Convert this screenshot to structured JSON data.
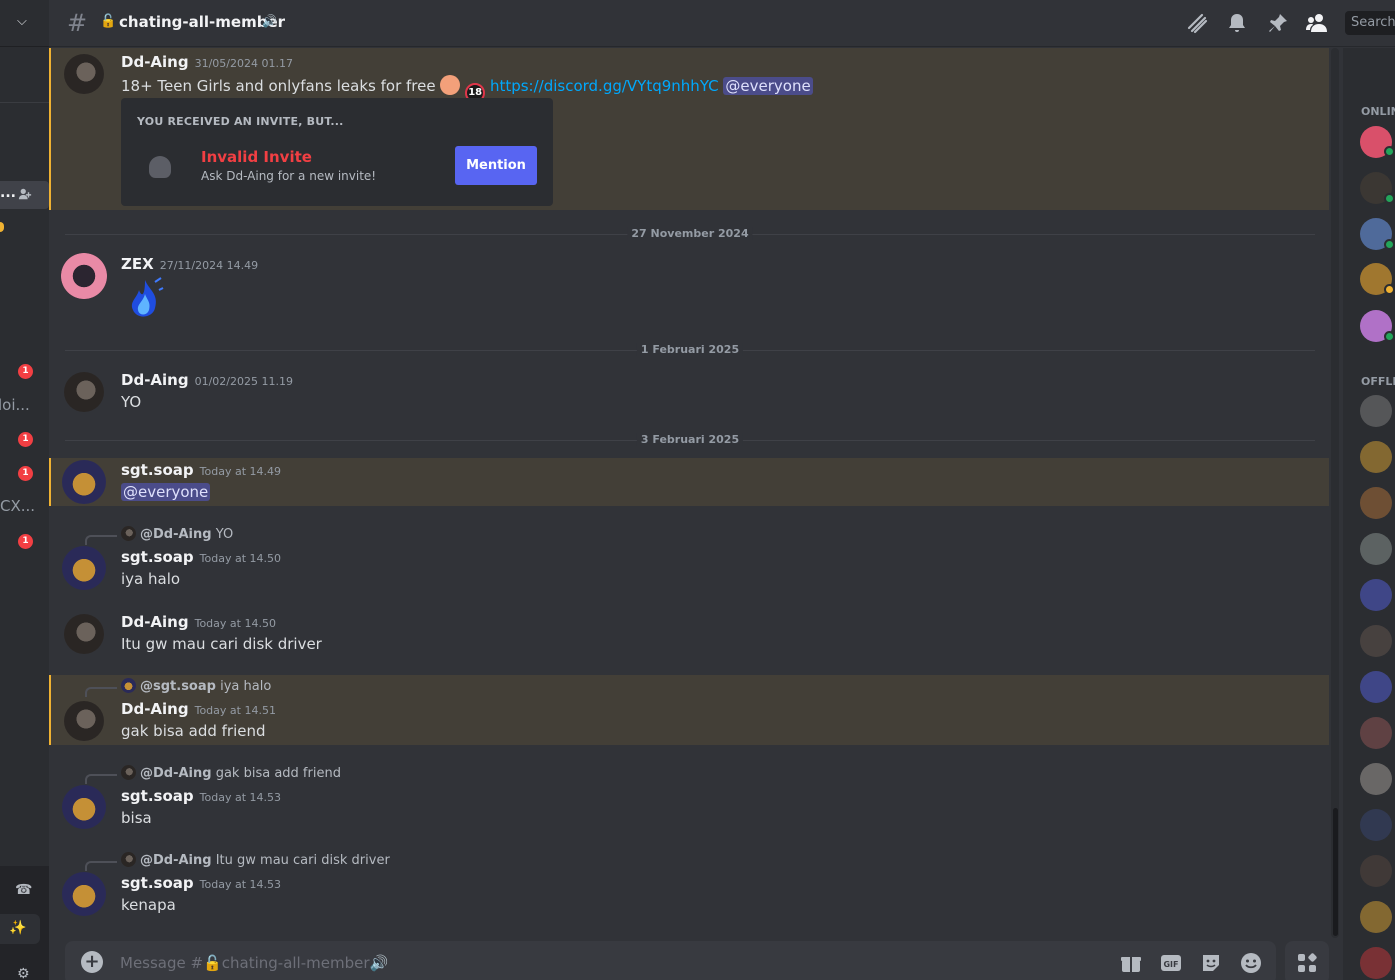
{
  "sidebar": {
    "dots": "...",
    "badges": [
      "1",
      "1",
      "1",
      "1"
    ],
    "truncated_items": [
      "loi...",
      "CX..."
    ]
  },
  "header": {
    "channel_name": "chating-all-member",
    "search_placeholder": "Search"
  },
  "messages": [
    {
      "author": "Dd-Aing",
      "time": "31/05/2024 01.17",
      "text_before_link": "18+ Teen Girls and onlyfans leaks for free",
      "link": "https://discord.gg/VYtq9nhhYC",
      "mention": "@everyone",
      "emoji": [
        "peach",
        "18"
      ],
      "invite": {
        "caption": "YOU RECEIVED AN INVITE, BUT...",
        "title": "Invalid Invite",
        "subtitle": "Ask Dd-Aing for a new invite!",
        "button": "Mention"
      }
    },
    {
      "author": "ZEX",
      "time": "27/11/2024 14.49",
      "sticker": "blue-flame"
    },
    {
      "author": "Dd-Aing",
      "time": "01/02/2025 11.19",
      "text": "YO"
    },
    {
      "author": "sgt.soap",
      "time": "Today at 14.49",
      "mention": "@everyone"
    },
    {
      "author": "sgt.soap",
      "time": "Today at 14.50",
      "text": "iya halo",
      "reply_to": "@Dd-Aing",
      "reply_text": "YO"
    },
    {
      "author": "Dd-Aing",
      "time": "Today at 14.50",
      "text": "Itu gw mau cari disk driver"
    },
    {
      "author": "Dd-Aing",
      "time": "Today at 14.51",
      "text": "gak bisa add friend",
      "reply_to": "@sgt.soap",
      "reply_text": "iya halo"
    },
    {
      "author": "sgt.soap",
      "time": "Today at 14.53",
      "text": "bisa",
      "reply_to": "@Dd-Aing",
      "reply_text": "gak bisa add friend"
    },
    {
      "author": "sgt.soap",
      "time": "Today at 14.53",
      "text": "kenapa",
      "reply_to": "@Dd-Aing",
      "reply_text": "Itu gw mau cari disk driver"
    }
  ],
  "dividers": [
    "27 November 2024",
    "1 Februari 2025",
    "3 Februari 2025"
  ],
  "composer": {
    "placeholder": "Message #🔓chating-all-member🔊"
  },
  "members": {
    "online_label": "ONLIN",
    "offline_label": "OFFLI"
  },
  "colors": {
    "background": "#313338",
    "sidebar": "#2b2d31",
    "highlight": "#433f37",
    "highlight_bar": "#f0b232",
    "mention_bg": "#4b4c8a",
    "link": "#00a8fc",
    "blurple": "#5865f2",
    "error_red": "#f23f43",
    "online_green": "#23a55a",
    "idle_yellow": "#f0b232"
  }
}
